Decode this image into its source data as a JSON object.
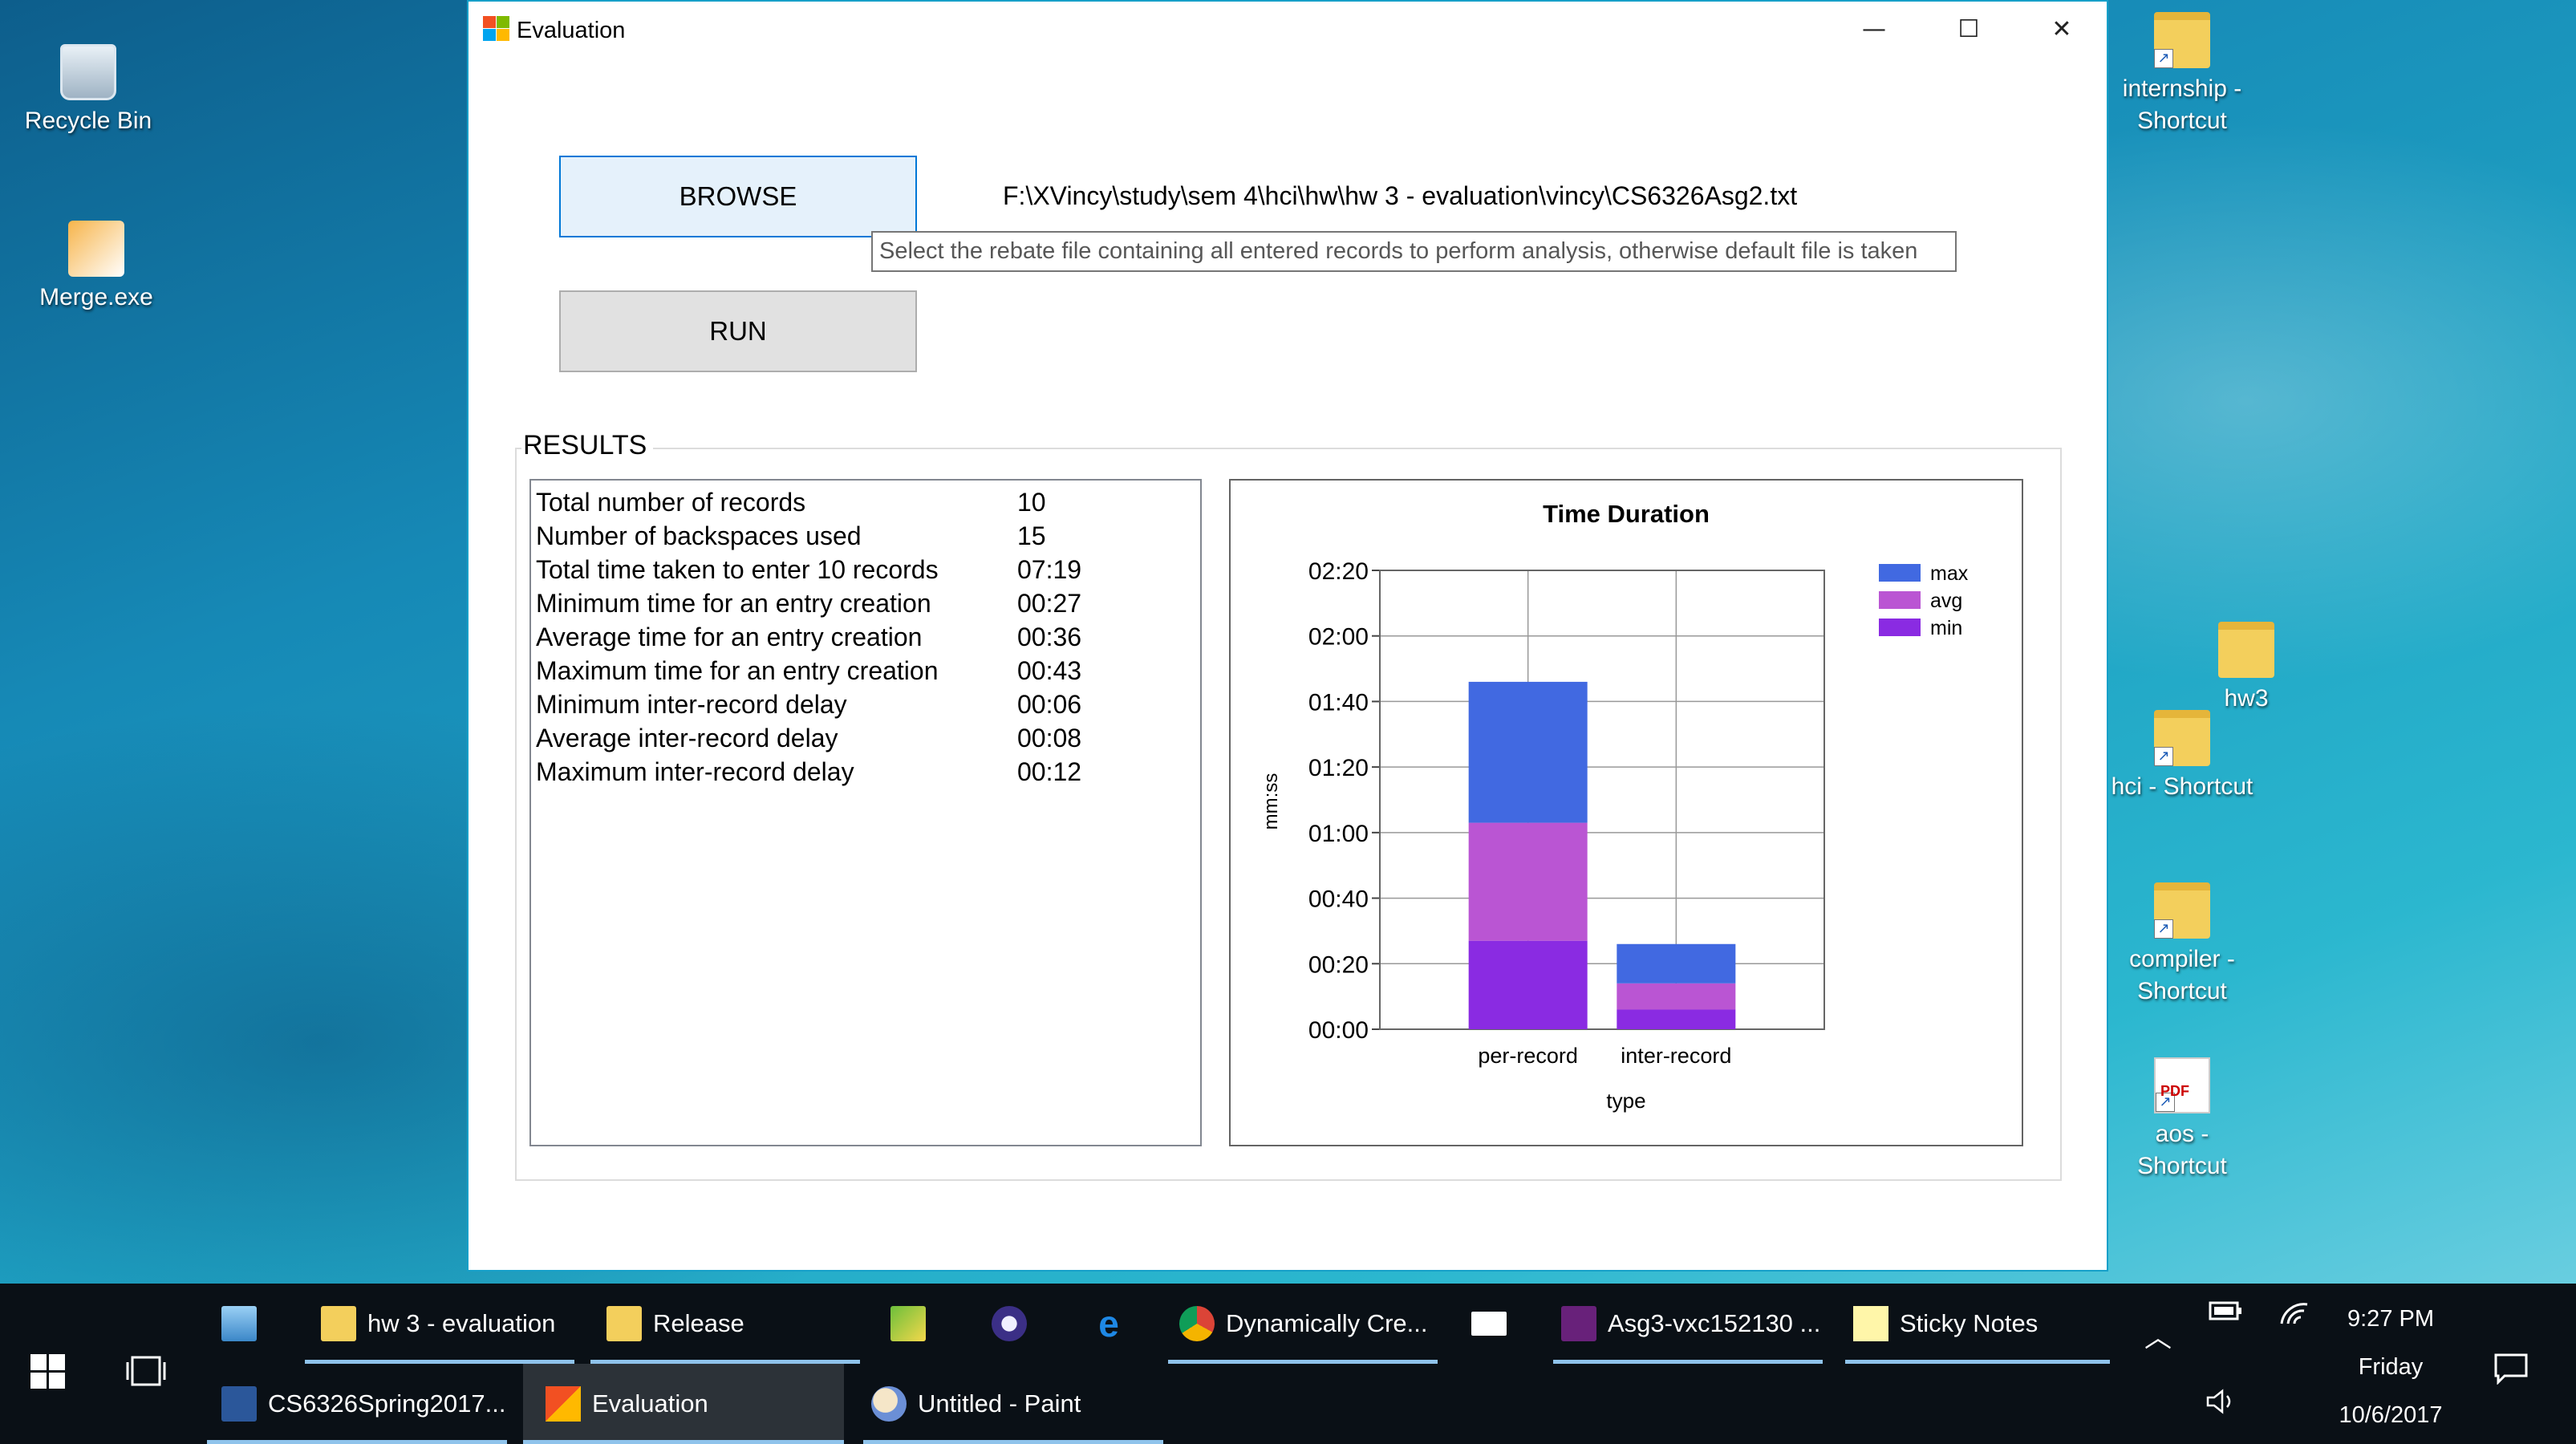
{
  "desktop": {
    "left_icons": [
      {
        "label": "Recycle Bin",
        "icon": "recycle-bin-icon"
      },
      {
        "label": "Merge.exe",
        "icon": "exe-icon"
      }
    ],
    "right_icons": [
      {
        "label": "internship - Shortcut",
        "icon": "folder-shortcut-icon"
      },
      {
        "label": "hw3",
        "icon": "folder-icon"
      },
      {
        "label": "hci - Shortcut",
        "icon": "folder-shortcut-icon"
      },
      {
        "label": "compiler - Shortcut",
        "icon": "folder-shortcut-icon"
      },
      {
        "label": "aos - Shortcut",
        "icon": "pdf-shortcut-icon"
      }
    ]
  },
  "window": {
    "title": "Evaluation",
    "controls": {
      "minimize": "—",
      "maximize": "☐",
      "close": "✕"
    },
    "browse_label": "BROWSE",
    "run_label": "RUN",
    "file_path": "F:\\XVincy\\study\\sem 4\\hci\\hw\\hw 3 - evaluation\\vincy\\CS6326Asg2.txt",
    "tooltip": "Select the rebate file containing all entered records to perform analysis, otherwise default file is taken",
    "results_title": "RESULTS",
    "results": [
      {
        "label": "Total number of records",
        "value": "10"
      },
      {
        "label": "Number of backspaces used",
        "value": "15"
      },
      {
        "label": "Total time taken to enter 10 records",
        "value": "07:19"
      },
      {
        "label": "Minimum time for an entry creation",
        "value": "00:27"
      },
      {
        "label": "Average time for an entry creation",
        "value": "00:36"
      },
      {
        "label": "Maximum time for an entry creation",
        "value": "00:43"
      },
      {
        "label": "Minimum inter-record delay",
        "value": "00:06"
      },
      {
        "label": "Average inter-record delay",
        "value": "00:08"
      },
      {
        "label": "Maximum inter-record delay",
        "value": "00:12"
      }
    ]
  },
  "chart_data": {
    "type": "bar",
    "stacked": true,
    "title": "Time Duration",
    "xlabel": "type",
    "ylabel": "mm:ss",
    "categories": [
      "per-record",
      "inter-record"
    ],
    "series": [
      {
        "name": "min",
        "values": [
          27,
          6
        ],
        "color": "#8a2be2"
      },
      {
        "name": "avg",
        "values": [
          36,
          8
        ],
        "color": "#ba55d3"
      },
      {
        "name": "max",
        "values": [
          43,
          12
        ],
        "color": "#4169e1"
      }
    ],
    "yticks": [
      "00:00",
      "00:20",
      "00:40",
      "01:00",
      "01:20",
      "01:40",
      "02:00",
      "02:20"
    ],
    "ylim": [
      0,
      140
    ],
    "legend": [
      "max",
      "avg",
      "min"
    ],
    "legend_position": "top-right",
    "grid": true
  },
  "taskbar": {
    "row1": [
      {
        "label": "",
        "icon": "laptop-icon"
      },
      {
        "label": "hw 3 - evaluation",
        "icon": "folder-icon"
      },
      {
        "label": "Release",
        "icon": "folder-icon"
      },
      {
        "label": "",
        "icon": "image-editor-icon"
      },
      {
        "label": "",
        "icon": "eclipse-icon"
      },
      {
        "label": "",
        "icon": "edge-icon"
      },
      {
        "label": "Dynamically Cre...",
        "icon": "chrome-icon"
      },
      {
        "label": "",
        "icon": "mail-icon"
      },
      {
        "label": "Asg3-vxc152130 ...",
        "icon": "visual-studio-icon"
      },
      {
        "label": "Sticky Notes",
        "icon": "sticky-notes-icon"
      }
    ],
    "row2": [
      {
        "label": "CS6326Spring2017...",
        "icon": "word-icon"
      },
      {
        "label": "Evaluation",
        "icon": "evaluation-app-icon"
      },
      {
        "label": "Untitled - Paint",
        "icon": "paint-icon"
      }
    ],
    "clock": {
      "time": "9:27 PM",
      "day": "Friday",
      "date": "10/6/2017"
    }
  }
}
